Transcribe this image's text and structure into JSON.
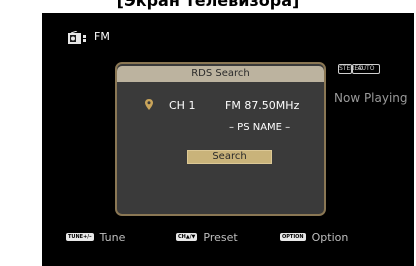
{
  "caption": "[Экран телевизора]",
  "source": {
    "icon": "radio-icon",
    "label": "FM"
  },
  "mode_badges": [
    "STEREO",
    "AUTO"
  ],
  "background_label": "Now Playing",
  "dialog": {
    "title": "RDS Search",
    "pin_icon": "location-pin-icon",
    "channel": "CH 1",
    "frequency": "FM 87.50MHz",
    "ps_name": "– PS NAME –",
    "button_label": "Search",
    "accent_color": "#c9b37a"
  },
  "bottom_bar": {
    "tune_key": "TUNE+/–",
    "tune_label": "Tune",
    "preset_key": "CH▲/▼",
    "preset_label": "Preset",
    "option_key": "OPTION",
    "option_label": "Option"
  }
}
